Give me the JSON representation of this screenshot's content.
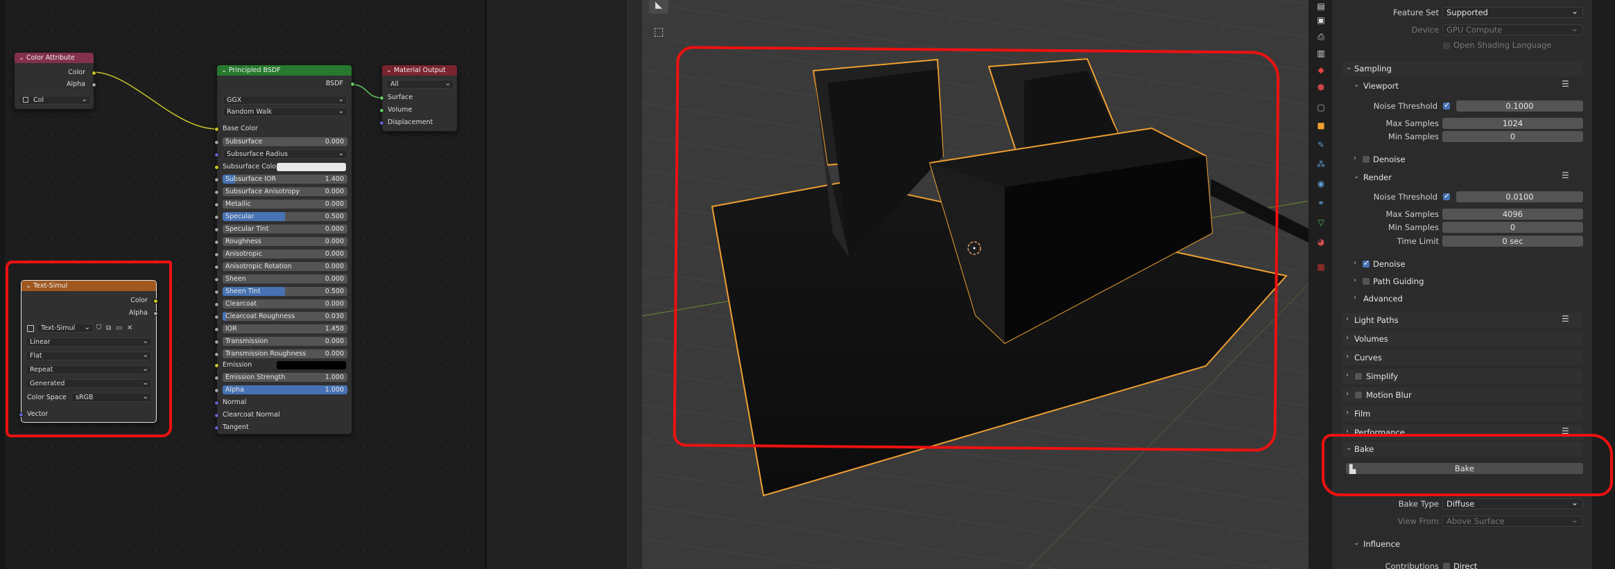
{
  "node_editor": {
    "color_attribute_node": {
      "title": "Color Attribute",
      "out_color": "Color",
      "out_alpha": "Alpha",
      "layer_value": "Col"
    },
    "principled_node": {
      "title": "Principled BSDF",
      "out_bsdf": "BSDF",
      "distribution": "GGX",
      "subsurface_method": "Random Walk",
      "base_color": "Base Color",
      "inputs": [
        {
          "label": "Subsurface",
          "value": "0.000",
          "fill": 0
        },
        {
          "label": "Subsurface Radius",
          "value": "",
          "fill": 0,
          "dropdown": true
        },
        {
          "label": "Subsurface Color",
          "value": "",
          "fill": 0,
          "swatch": "#e8e8e8"
        },
        {
          "label": "Subsurface IOR",
          "value": "1.400",
          "fill": 0.1
        },
        {
          "label": "Subsurface Anisotropy",
          "value": "0.000",
          "fill": 0
        },
        {
          "label": "Metallic",
          "value": "0.000",
          "fill": 0
        },
        {
          "label": "Specular",
          "value": "0.500",
          "fill": 0.5
        },
        {
          "label": "Specular Tint",
          "value": "0.000",
          "fill": 0
        },
        {
          "label": "Roughness",
          "value": "0.000",
          "fill": 0
        },
        {
          "label": "Anisotropic",
          "value": "0.000",
          "fill": 0
        },
        {
          "label": "Anisotropic Rotation",
          "value": "0.000",
          "fill": 0
        },
        {
          "label": "Sheen",
          "value": "0.000",
          "fill": 0
        },
        {
          "label": "Sheen Tint",
          "value": "0.500",
          "fill": 0.5
        },
        {
          "label": "Clearcoat",
          "value": "0.000",
          "fill": 0
        },
        {
          "label": "Clearcoat Roughness",
          "value": "0.030",
          "fill": 0.03
        },
        {
          "label": "IOR",
          "value": "1.450",
          "fill": 0
        },
        {
          "label": "Transmission",
          "value": "0.000",
          "fill": 0
        },
        {
          "label": "Transmission Roughness",
          "value": "0.000",
          "fill": 0
        }
      ],
      "emission": "Emission",
      "emission_swatch": "#000000",
      "emission_strength": {
        "label": "Emission Strength",
        "value": "1.000"
      },
      "alpha": {
        "label": "Alpha",
        "value": "1.000",
        "fill": 1
      },
      "normal": "Normal",
      "clearcoat_normal": "Clearcoat Normal",
      "tangent": "Tangent"
    },
    "material_output_node": {
      "title": "Material Output",
      "target": "All",
      "surface": "Surface",
      "volume": "Volume",
      "displacement": "Displacement"
    },
    "image_texture_node": {
      "title": "Text-Simul",
      "out_color": "Color",
      "out_alpha": "Alpha",
      "image_name": "Text-Simul",
      "interpolation": "Linear",
      "projection": "Flat",
      "extension": "Repeat",
      "source": "Generated",
      "color_space_label": "Color Space",
      "color_space": "sRGB",
      "vector": "Vector"
    }
  },
  "properties": {
    "feature_set": {
      "label": "Feature Set",
      "value": "Supported"
    },
    "device": {
      "label": "Device",
      "value": "GPU Compute"
    },
    "open_shading_language": "Open Shading Language",
    "sampling": "Sampling",
    "viewport": {
      "title": "Viewport",
      "noise_threshold_label": "Noise Threshold",
      "noise_threshold": "0.1000",
      "max_samples_label": "Max Samples",
      "max_samples": "1024",
      "min_samples_label": "Min Samples",
      "min_samples": "0",
      "denoise": "Denoise"
    },
    "render": {
      "title": "Render",
      "noise_threshold_label": "Noise Threshold",
      "noise_threshold": "0.0100",
      "max_samples_label": "Max Samples",
      "max_samples": "4096",
      "min_samples_label": "Min Samples",
      "min_samples": "0",
      "time_limit_label": "Time Limit",
      "time_limit": "0 sec",
      "denoise": "Denoise",
      "path_guiding": "Path Guiding",
      "advanced": "Advanced"
    },
    "panels": [
      "Light Paths",
      "Volumes",
      "Curves",
      "Simplify",
      "Motion Blur",
      "Film",
      "Performance"
    ],
    "bake": {
      "title": "Bake",
      "button": "Bake",
      "bake_type_label": "Bake Type",
      "bake_type": "Diffuse",
      "view_from_label": "View From",
      "view_from": "Above Surface",
      "influence": "Influence",
      "contributions_label": "Contributions",
      "direct": "Direct"
    }
  },
  "colors": {
    "annotation": "#ee1111",
    "selection_outline": "#f0a030",
    "accent": "#4772b3"
  }
}
